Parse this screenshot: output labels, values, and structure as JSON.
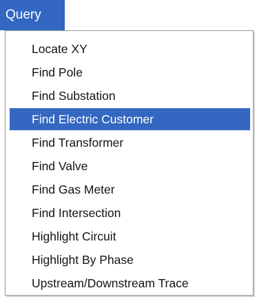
{
  "menubar": {
    "title": "Query"
  },
  "menu": {
    "selected_index": 3,
    "items": [
      {
        "label": "Locate XY"
      },
      {
        "label": "Find Pole"
      },
      {
        "label": "Find Substation"
      },
      {
        "label": "Find Electric Customer"
      },
      {
        "label": "Find Transformer"
      },
      {
        "label": "Find Valve"
      },
      {
        "label": "Find Gas Meter"
      },
      {
        "label": "Find Intersection"
      },
      {
        "label": "Highlight Circuit"
      },
      {
        "label": "Highlight By Phase"
      },
      {
        "label": "Upstream/Downstream Trace"
      }
    ]
  },
  "colors": {
    "highlight": "#3367c1",
    "highlight_text": "#ffffff",
    "menu_text": "#141414",
    "menu_border": "#9a9a9a"
  }
}
